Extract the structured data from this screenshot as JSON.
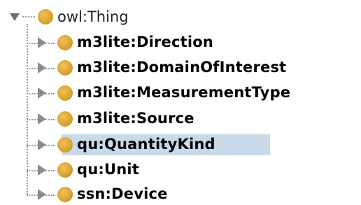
{
  "tree": {
    "root": {
      "label": "owl:Thing",
      "expanded": true,
      "icon": "class-icon"
    },
    "children": [
      {
        "label": "m3lite:Direction",
        "selected": false
      },
      {
        "label": "m3lite:DomainOfInterest",
        "selected": false
      },
      {
        "label": "m3lite:MeasurementType",
        "selected": false
      },
      {
        "label": "m3lite:Source",
        "selected": false
      },
      {
        "label": "qu:QuantityKind",
        "selected": true
      },
      {
        "label": "qu:Unit",
        "selected": false
      },
      {
        "label": "ssn:Device",
        "selected": false
      }
    ]
  },
  "colors": {
    "class_dot": "#d8a12e",
    "selection": "#c8d9ea",
    "connector": "#9a9a9a"
  }
}
